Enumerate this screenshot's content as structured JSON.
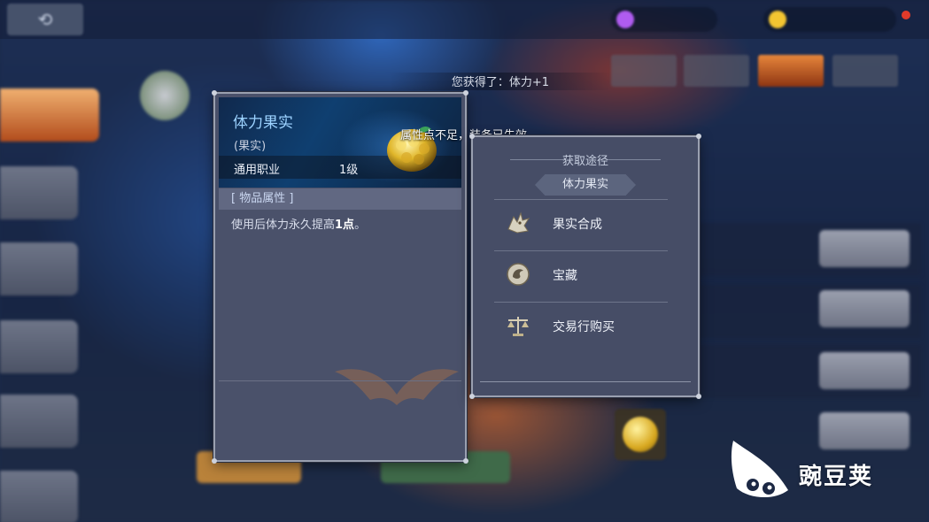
{
  "toast": "您获得了：体力+1",
  "warning": "属性点不足，装备已失效",
  "item": {
    "name": "体力果实",
    "type": "(果实)",
    "class": "通用职业",
    "level": "1级",
    "attr_header": "[ 物品属性 ]",
    "desc_prefix": "使用后体力永久提高",
    "desc_value": "1点",
    "desc_suffix": "。"
  },
  "source": {
    "title": "获取途径",
    "subtitle": "体力果实",
    "items": [
      {
        "label": "果实合成",
        "icon": "dragon-head-icon"
      },
      {
        "label": "宝藏",
        "icon": "dragon-emblem-icon"
      },
      {
        "label": "交易行购买",
        "icon": "scales-icon"
      }
    ]
  },
  "watermark": {
    "text": "豌豆荚"
  },
  "colors": {
    "item_name": "#9cd2ff",
    "panel_bg": "#4a516a",
    "active_tab": "#e7863b"
  }
}
